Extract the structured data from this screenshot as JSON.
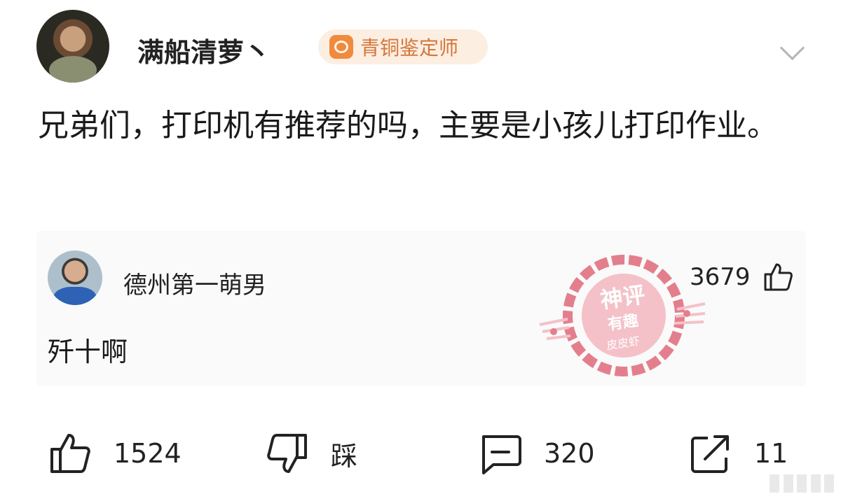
{
  "post": {
    "author": "满船清萝丶",
    "badge": "青铜鉴定师",
    "text": "兄弟们，打印机有推荐的吗，主要是小孩儿打印作业。"
  },
  "comment": {
    "author": "德州第一萌男",
    "likes": "3679",
    "text": "歼十啊"
  },
  "stamp": {
    "line1": "神评",
    "line2": "有趣",
    "line3": "皮皮虾"
  },
  "actions": {
    "like_count": "1524",
    "dislike_label": "踩",
    "comment_count": "320",
    "share_count": "11"
  },
  "colors": {
    "badge_bg": "#fdeee2",
    "badge_text": "#d2763a",
    "stamp": "#e06a7a",
    "comment_bg": "#fafafa"
  },
  "icons": [
    "badge-icon",
    "chevron-down-icon",
    "thumb-up-icon",
    "thumb-down-icon",
    "comment-icon",
    "share-icon"
  ]
}
